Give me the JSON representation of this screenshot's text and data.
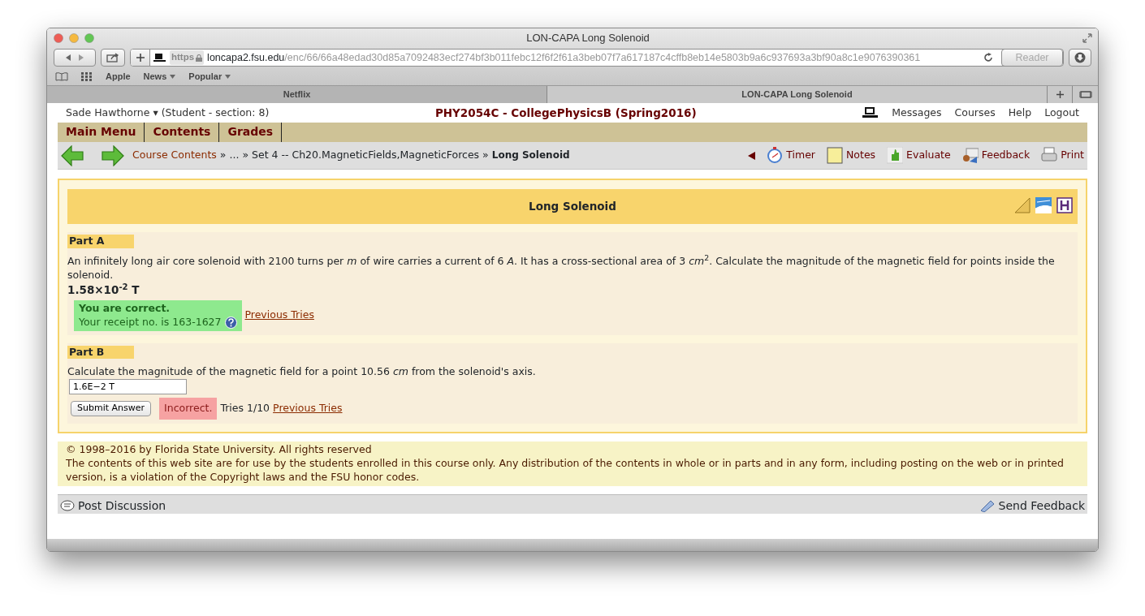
{
  "window": {
    "title": "LON-CAPA Long Solenoid"
  },
  "toolbar": {
    "address": {
      "scheme": "https",
      "host": "loncapa2.fsu.edu",
      "path": "/enc/66/66a48edad30d85a7092483ecf274bf3b011febc12f6f2f61a3beb07f7a617187c4cffb8eb14e5803b9a6c937693a3bf90a8c1e9076390361"
    },
    "reader": "Reader"
  },
  "bookmarks": [
    {
      "label": "Apple",
      "menu": false
    },
    {
      "label": "News",
      "menu": true
    },
    {
      "label": "Popular",
      "menu": true
    }
  ],
  "tabs": [
    {
      "label": "Netflix",
      "selected": false
    },
    {
      "label": "LON-CAPA Long Solenoid",
      "selected": true
    }
  ],
  "header": {
    "user": "Sade Hawthorne ▾",
    "role": "(Student  - section: 8)",
    "course": "PHY2054C - CollegePhysicsB (Spring2016)",
    "links": [
      "Messages",
      "Courses",
      "Help",
      "Logout"
    ]
  },
  "main_menu": [
    {
      "label": "Main Menu"
    },
    {
      "label": "Contents"
    },
    {
      "label": "Grades"
    }
  ],
  "breadcrumb": [
    {
      "label": "Course Contents",
      "kind": "link",
      "sep": "»"
    },
    {
      "label": "...",
      "kind": "text",
      "sep": "»"
    },
    {
      "label": "Set 4 -- Ch20.MagneticFields,MagneticForces",
      "kind": "text",
      "sep": "»"
    },
    {
      "label": "Long Solenoid",
      "kind": "current"
    }
  ],
  "tools": [
    {
      "label": "Timer",
      "kind": "timer"
    },
    {
      "label": "Notes",
      "kind": "notes"
    },
    {
      "label": "Evaluate",
      "kind": "evaluate"
    },
    {
      "label": "Feedback",
      "kind": "feedback"
    },
    {
      "label": "Print",
      "kind": "print"
    }
  ],
  "problem": {
    "title": "Long Solenoid",
    "parts": [
      {
        "label": "Part A",
        "text": "An infinitely long air core solenoid with 2100 turns per *m* of wire carries a current of 6 *A*. It has a cross-sectional area of 3 *cm*$^{2}$. Calculate the magnitude of the magnetic field for points inside the solenoid.",
        "answer": "1.58×10$^{-2}$ T",
        "kind": "correct",
        "message": "You are correct.",
        "receipt": "Your receipt no. is 163-1627",
        "previous": "Previous Tries"
      },
      {
        "label": "Part B",
        "text": "Calculate the magnitude of the magnetic field for a point 10.56 *cm* from the solenoid's axis.",
        "value": "1.6E−2 T",
        "submit": "Submit Answer",
        "kind": "incorrect",
        "message": "Incorrect.",
        "tries": "Tries 1/10",
        "previous": "Previous Tries"
      }
    ]
  },
  "footer": {
    "copyright": "© 1998–2016 by Florida State University. All rights reserved",
    "notice": "The contents of this web site are for use by the students enrolled in this course only. Any distribution of the contents in whole or in parts and in any form, including posting on the web or in printed version, is a violation of the Copyright laws and the FSU honor codes."
  },
  "bottom": {
    "left": "Post Discussion",
    "right": "Send Feedback"
  }
}
